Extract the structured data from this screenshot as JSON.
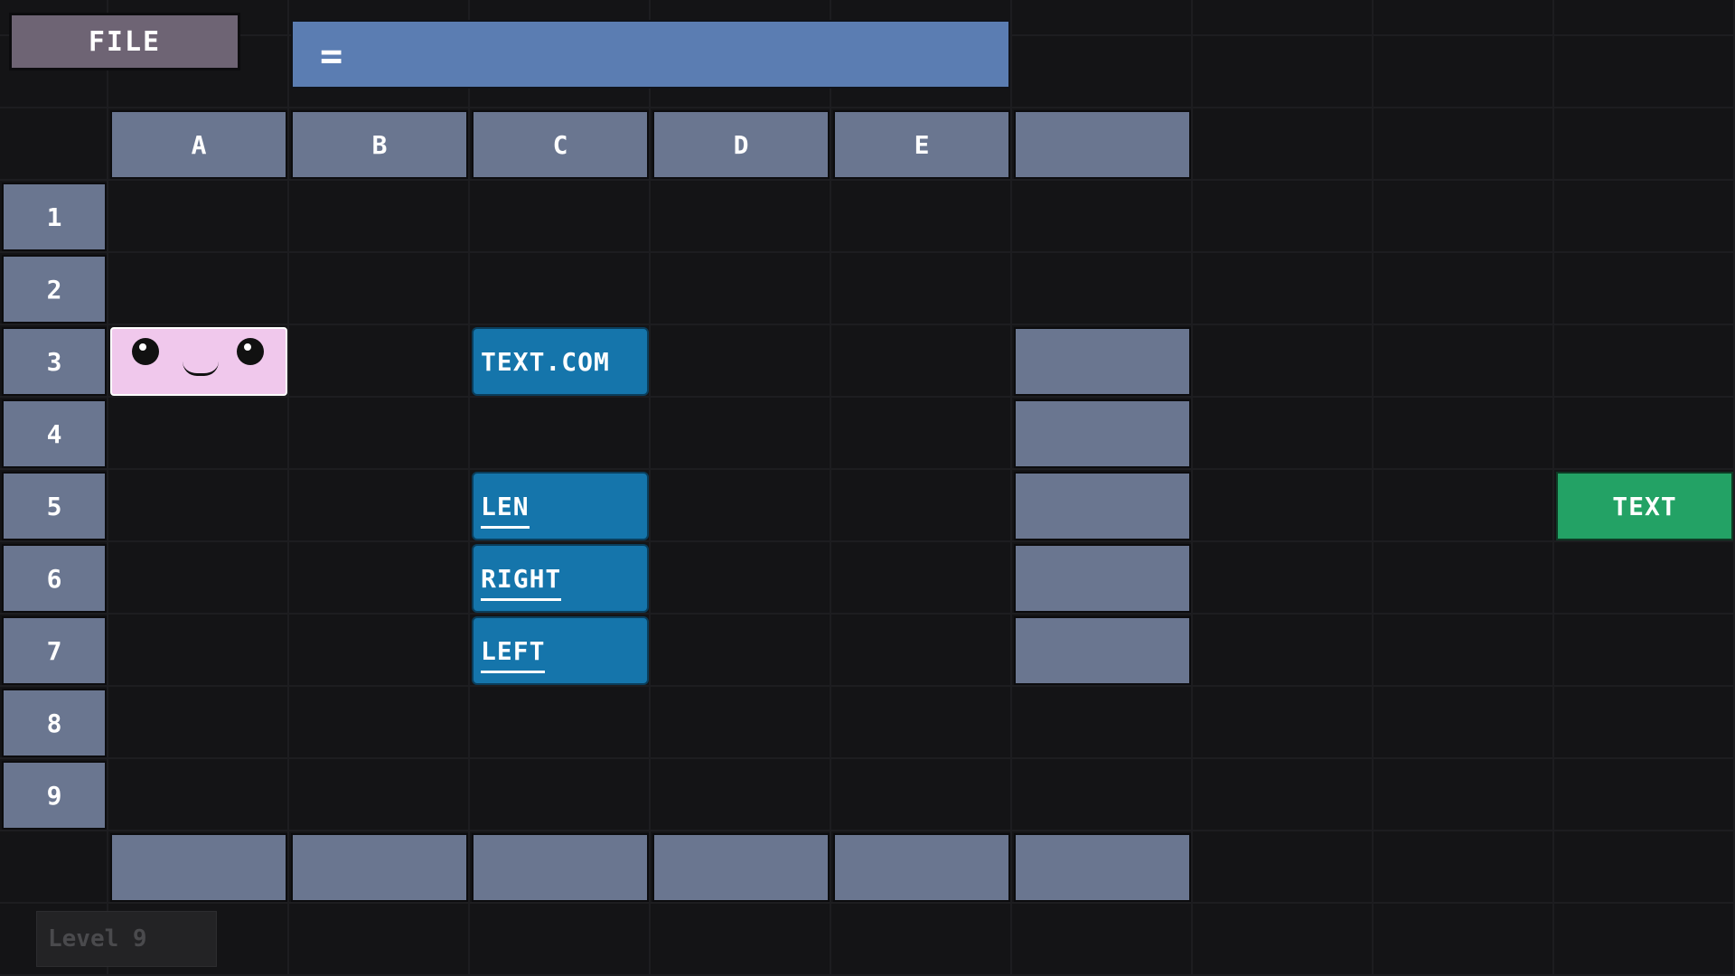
{
  "toolbar": {
    "file_label": "FILE"
  },
  "formula_bar": {
    "prefix": "="
  },
  "grid": {
    "columns": [
      "A",
      "B",
      "C",
      "D",
      "E",
      ""
    ],
    "rows": [
      "1",
      "2",
      "3",
      "4",
      "5",
      "6",
      "7",
      "8",
      "9"
    ]
  },
  "blocks": {
    "text_com": "TEXT.COM",
    "len": "LEN",
    "right": "RIGHT",
    "left": "LEFT",
    "text": "TEXT"
  },
  "colors": {
    "background": "#141416",
    "header": "#6a7690",
    "formula_bar": "#5b7db2",
    "function_block": "#1575ab",
    "text_block": "#23a265",
    "face_block": "#f0c8ec",
    "file_button": "#6e6474"
  },
  "status": {
    "level": "Level 9"
  }
}
